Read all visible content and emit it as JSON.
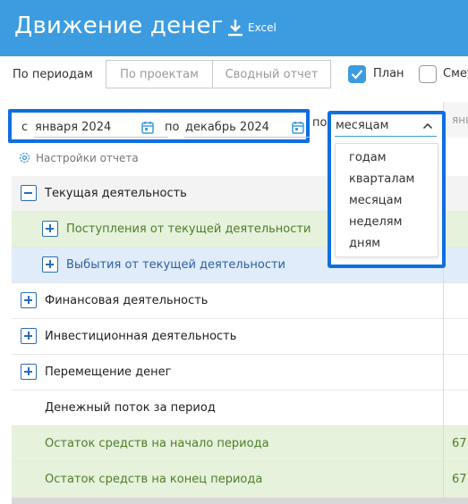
{
  "header": {
    "title": "Движение денег",
    "excel_label": "Excel",
    "bg_color": "#3d9ce0"
  },
  "tabs": [
    {
      "label": "По периодам",
      "active": true
    },
    {
      "label": "По проектам",
      "active": false
    },
    {
      "label": "Сводный отчет",
      "active": false
    }
  ],
  "checkboxes": [
    {
      "label": "План",
      "checked": true
    },
    {
      "label": "Смет",
      "checked": false
    }
  ],
  "filters": {
    "from_label": "с",
    "from_value": "января 2024",
    "to_label": "по",
    "to_value": "декабрь 2024",
    "by_label": "по",
    "period_value": "месяцам",
    "period_options": [
      "годам",
      "кварталам",
      "месяцам",
      "неделям",
      "дням"
    ]
  },
  "settings_label": "Настройки отчета",
  "column_header": "янв",
  "rows": [
    {
      "label": "Текущая деятельность",
      "toggle": "minus",
      "value": ""
    },
    {
      "label": "Поступления от текущей деятельности",
      "toggle": "plus",
      "value": ""
    },
    {
      "label": "Выбытия от текущей деятельности",
      "toggle": "plus",
      "value": ""
    },
    {
      "label": "Финансовая деятельность",
      "toggle": "plus",
      "value": ""
    },
    {
      "label": "Инвестиционная деятельность",
      "toggle": "plus",
      "value": ""
    },
    {
      "label": "Перемещение денег",
      "toggle": "plus",
      "value": ""
    },
    {
      "label": "Денежный поток за период",
      "toggle": "none",
      "value": ""
    },
    {
      "label": "Остаток средств на начало периода",
      "toggle": "none",
      "value": "67"
    },
    {
      "label": "Остаток средств на конец периода",
      "toggle": "none",
      "value": "67"
    }
  ],
  "accent_colors": {
    "highlight_border": "#0f6fe0",
    "income": "#4f7d29",
    "expense": "#2b5fa3"
  }
}
